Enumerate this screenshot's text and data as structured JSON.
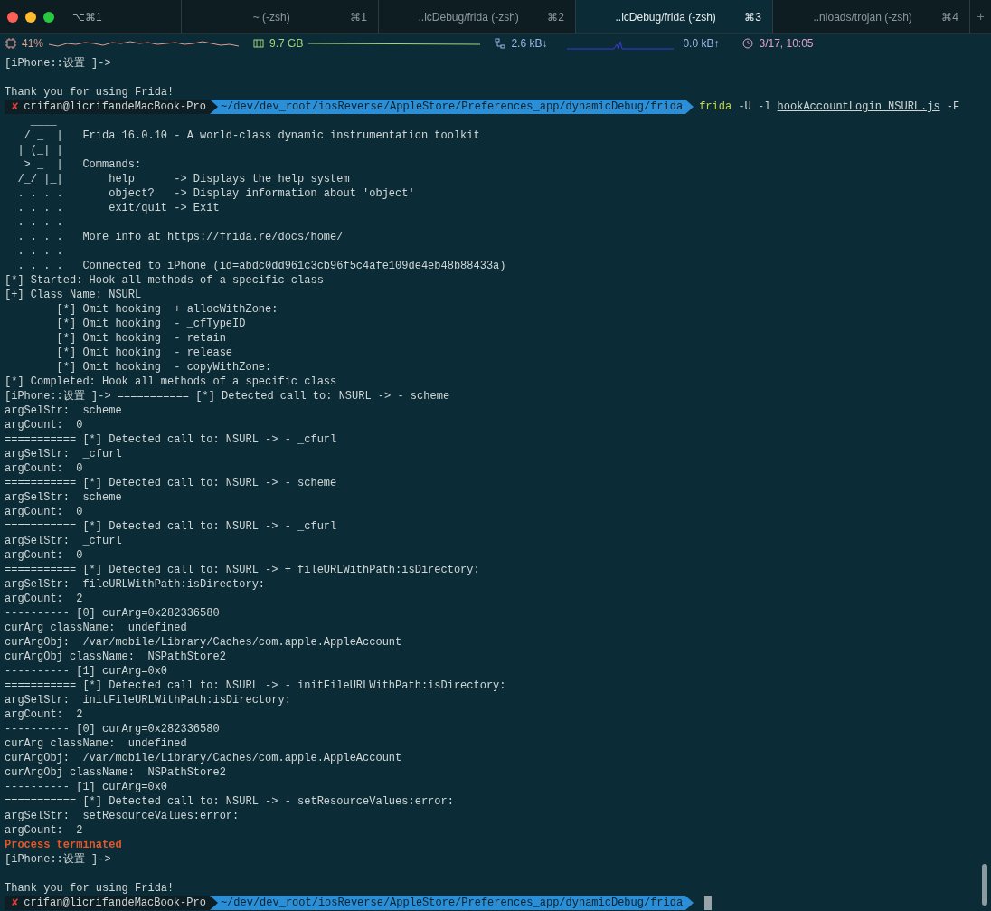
{
  "window": {
    "shortcut": "⌥⌘1"
  },
  "tabs": [
    {
      "title": "~ (-zsh)",
      "shortcut": "⌘1",
      "selected": false
    },
    {
      "title": "..icDebug/frida (-zsh)",
      "shortcut": "⌘2",
      "selected": false
    },
    {
      "title": "..icDebug/frida (-zsh)",
      "shortcut": "⌘3",
      "selected": true
    },
    {
      "title": "..nloads/trojan (-zsh)",
      "shortcut": "⌘4",
      "selected": false
    }
  ],
  "new_tab": "+",
  "status_bar": {
    "cpu": "41%",
    "memory": "9.7 GB",
    "download": "2.6 kB↓",
    "upload": "0.0 kB↑",
    "clock": "3/17, 10:05"
  },
  "lines": [
    {
      "kind": "text",
      "text": "[iPhone::设置 ]->"
    },
    {
      "kind": "blank"
    },
    {
      "kind": "text",
      "text": "Thank you for using Frida!"
    },
    {
      "kind": "prompt",
      "status": "✘",
      "user": "crifan@licrifandeMacBook-Pro",
      "path": "~/dev/dev_root/iosReverse/AppleStore/Preferences_app/dynamicDebug/frida",
      "command": "frida",
      "args": "-U -l",
      "file": "hookAccountLogin_NSURL.js",
      "flag": "-F"
    },
    {
      "kind": "text",
      "text": "    ____"
    },
    {
      "kind": "text",
      "text": "   / _  |   Frida 16.0.10 - A world-class dynamic instrumentation toolkit"
    },
    {
      "kind": "text",
      "text": "  | (_| |"
    },
    {
      "kind": "text",
      "text": "   > _  |   Commands:"
    },
    {
      "kind": "text",
      "text": "  /_/ |_|       help      -> Displays the help system"
    },
    {
      "kind": "text",
      "text": "  . . . .       object?   -> Display information about 'object'"
    },
    {
      "kind": "text",
      "text": "  . . . .       exit/quit -> Exit"
    },
    {
      "kind": "text",
      "text": "  . . . ."
    },
    {
      "kind": "text",
      "text": "  . . . .   More info at https://frida.re/docs/home/"
    },
    {
      "kind": "text",
      "text": "  . . . ."
    },
    {
      "kind": "text",
      "text": "  . . . .   Connected to iPhone (id=abdc0dd961c3cb96f5c4afe109de4eb48b88433a)"
    },
    {
      "kind": "text",
      "text": "[*] Started: Hook all methods of a specific class"
    },
    {
      "kind": "text",
      "text": "[+] Class Name: NSURL"
    },
    {
      "kind": "text",
      "text": "        [*] Omit hooking  + allocWithZone:"
    },
    {
      "kind": "text",
      "text": "        [*] Omit hooking  - _cfTypeID"
    },
    {
      "kind": "text",
      "text": "        [*] Omit hooking  - retain"
    },
    {
      "kind": "text",
      "text": "        [*] Omit hooking  - release"
    },
    {
      "kind": "text",
      "text": "        [*] Omit hooking  - copyWithZone:"
    },
    {
      "kind": "text",
      "text": "[*] Completed: Hook all methods of a specific class"
    },
    {
      "kind": "text",
      "text": "[iPhone::设置 ]-> =========== [*] Detected call to: NSURL -> - scheme"
    },
    {
      "kind": "text",
      "text": "argSelStr:  scheme"
    },
    {
      "kind": "text",
      "text": "argCount:  0"
    },
    {
      "kind": "text",
      "text": "=========== [*] Detected call to: NSURL -> - _cfurl"
    },
    {
      "kind": "text",
      "text": "argSelStr:  _cfurl"
    },
    {
      "kind": "text",
      "text": "argCount:  0"
    },
    {
      "kind": "text",
      "text": "=========== [*] Detected call to: NSURL -> - scheme"
    },
    {
      "kind": "text",
      "text": "argSelStr:  scheme"
    },
    {
      "kind": "text",
      "text": "argCount:  0"
    },
    {
      "kind": "text",
      "text": "=========== [*] Detected call to: NSURL -> - _cfurl"
    },
    {
      "kind": "text",
      "text": "argSelStr:  _cfurl"
    },
    {
      "kind": "text",
      "text": "argCount:  0"
    },
    {
      "kind": "text",
      "text": "=========== [*] Detected call to: NSURL -> + fileURLWithPath:isDirectory:"
    },
    {
      "kind": "text",
      "text": "argSelStr:  fileURLWithPath:isDirectory:"
    },
    {
      "kind": "text",
      "text": "argCount:  2"
    },
    {
      "kind": "text",
      "text": "---------- [0] curArg=0x282336580"
    },
    {
      "kind": "text",
      "text": "curArg className:  undefined"
    },
    {
      "kind": "text",
      "text": "curArgObj:  /var/mobile/Library/Caches/com.apple.AppleAccount"
    },
    {
      "kind": "text",
      "text": "curArgObj className:  NSPathStore2"
    },
    {
      "kind": "text",
      "text": "---------- [1] curArg=0x0"
    },
    {
      "kind": "text",
      "text": "=========== [*] Detected call to: NSURL -> - initFileURLWithPath:isDirectory:"
    },
    {
      "kind": "text",
      "text": "argSelStr:  initFileURLWithPath:isDirectory:"
    },
    {
      "kind": "text",
      "text": "argCount:  2"
    },
    {
      "kind": "text",
      "text": "---------- [0] curArg=0x282336580"
    },
    {
      "kind": "text",
      "text": "curArg className:  undefined"
    },
    {
      "kind": "text",
      "text": "curArgObj:  /var/mobile/Library/Caches/com.apple.AppleAccount"
    },
    {
      "kind": "text",
      "text": "curArgObj className:  NSPathStore2"
    },
    {
      "kind": "text",
      "text": "---------- [1] curArg=0x0"
    },
    {
      "kind": "text",
      "text": "=========== [*] Detected call to: NSURL -> - setResourceValues:error:"
    },
    {
      "kind": "text",
      "text": "argSelStr:  setResourceValues:error:"
    },
    {
      "kind": "text",
      "text": "argCount:  2"
    },
    {
      "kind": "error",
      "text": "Process terminated"
    },
    {
      "kind": "text",
      "text": "[iPhone::设置 ]->"
    },
    {
      "kind": "blank"
    },
    {
      "kind": "text",
      "text": "Thank you for using Frida!"
    },
    {
      "kind": "prompt",
      "status": "✘",
      "user": "crifan@licrifandeMacBook-Pro",
      "path": "~/dev/dev_root/iosReverse/AppleStore/Preferences_app/dynamicDebug/frida"
    }
  ]
}
